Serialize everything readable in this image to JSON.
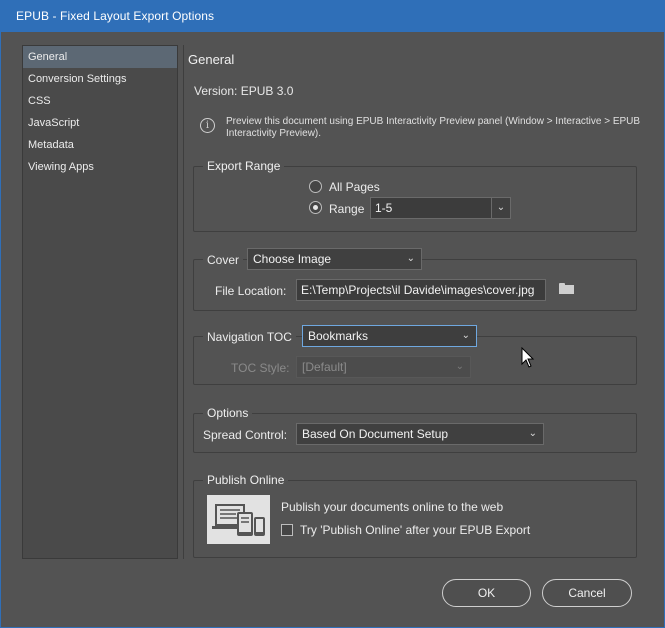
{
  "window": {
    "title": "EPUB - Fixed Layout Export Options"
  },
  "sidebar": {
    "items": [
      {
        "label": "General",
        "active": true
      },
      {
        "label": "Conversion Settings"
      },
      {
        "label": "CSS"
      },
      {
        "label": "JavaScript"
      },
      {
        "label": "Metadata"
      },
      {
        "label": "Viewing Apps"
      }
    ]
  },
  "main": {
    "header": "General",
    "version": "Version: EPUB 3.0",
    "info_text": "Preview this document using EPUB Interactivity Preview panel (Window > Interactive > EPUB Interactivity Preview).",
    "export_range": {
      "legend": "Export Range",
      "all_pages_label": "All Pages",
      "range_label": "Range",
      "range_value": "1-5",
      "selected": "range"
    },
    "cover": {
      "label": "Cover",
      "dropdown_value": "Choose Image",
      "file_location_label": "File Location:",
      "file_location_value": "E:\\Temp\\Projects\\il Davide\\images\\cover.jpg"
    },
    "navigation_toc": {
      "label": "Navigation TOC",
      "dropdown_value": "Bookmarks",
      "toc_style_label": "TOC Style:",
      "toc_style_value": "[Default]"
    },
    "options": {
      "legend": "Options",
      "spread_control_label": "Spread Control:",
      "spread_control_value": "Based On Document Setup"
    },
    "publish_online": {
      "legend": "Publish Online",
      "headline": "Publish your documents online to the web",
      "checkbox_label": "Try 'Publish Online' after your EPUB Export",
      "checked": false
    }
  },
  "footer": {
    "ok_label": "OK",
    "cancel_label": "Cancel"
  },
  "colors": {
    "titlebar": "#2f6fb8",
    "background": "#535353",
    "selected_item": "#5c6874",
    "focus_border": "#6fa8e0"
  }
}
